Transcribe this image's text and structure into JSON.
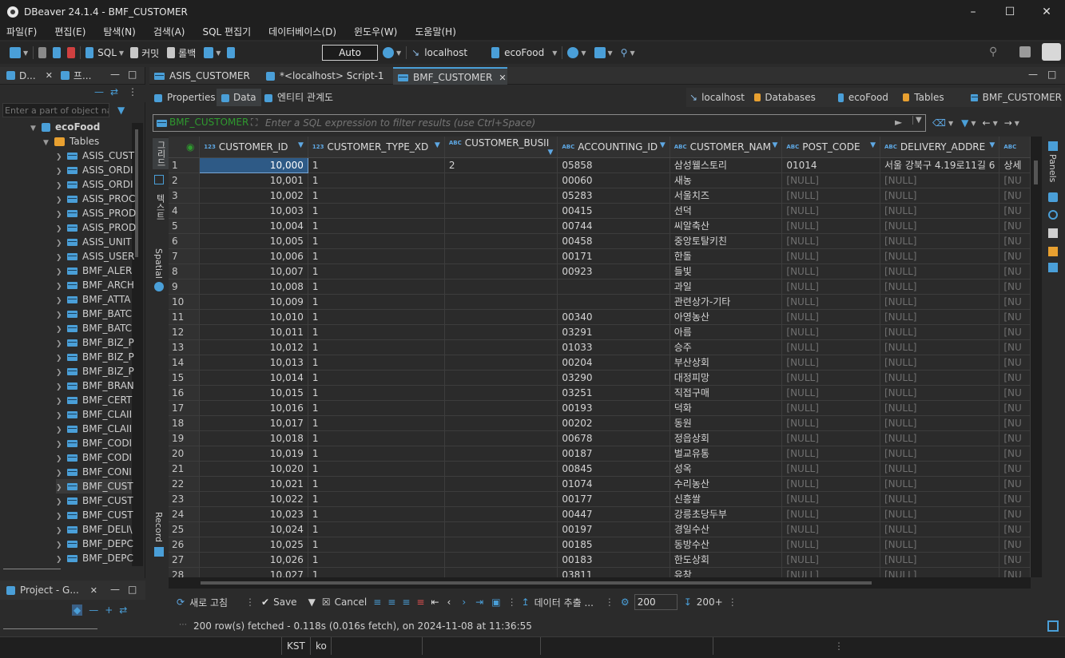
{
  "window": {
    "title": "DBeaver 24.1.4 - BMF_CUSTOMER"
  },
  "menu": [
    "파일(F)",
    "편집(E)",
    "탐색(N)",
    "검색(A)",
    "SQL 편집기",
    "데이터베이스(D)",
    "윈도우(W)",
    "도움말(H)"
  ],
  "toolbar": {
    "sql": "SQL",
    "commit": "커밋",
    "rollback": "롤백",
    "auto": "Auto",
    "connection": "localhost",
    "database": "ecoFood"
  },
  "left": {
    "tabs": [
      "D...",
      "프..."
    ],
    "filter_placeholder": "Enter a part of object na",
    "tree_db": "ecoFood",
    "tree_tables": "Tables",
    "tables": [
      "ASIS_CUST",
      "ASIS_ORDI",
      "ASIS_ORDI",
      "ASIS_PROC",
      "ASIS_PROD",
      "ASIS_PROD",
      "ASIS_UNIT",
      "ASIS_USER",
      "BMF_ALER",
      "BMF_ARCH",
      "BMF_ATTA",
      "BMF_BATC",
      "BMF_BATC",
      "BMF_BIZ_P",
      "BMF_BIZ_P",
      "BMF_BIZ_P",
      "BMF_BRAN",
      "BMF_CERT",
      "BMF_CLAII",
      "BMF_CLAII",
      "BMF_CODI",
      "BMF_CODI",
      "BMF_CONI",
      "BMF_CUST",
      "BMF_CUST",
      "BMF_CUST",
      "BMF_DELI\\",
      "BMF_DEPC",
      "BMF_DEPC"
    ],
    "project_tab": "Project - G..."
  },
  "editor": {
    "tabs": [
      "ASIS_CUSTOMER",
      "*<localhost> Script-1",
      "BMF_CUSTOMER"
    ],
    "subtabs": [
      "Properties",
      "Data",
      "엔티티 관계도"
    ],
    "breadcrumb": [
      "localhost",
      "Databases",
      "ecoFood",
      "Tables",
      "BMF_CUSTOMER"
    ],
    "filter_table": "BMF_CUSTOMER",
    "filter_placeholder": "Enter a SQL expression to filter results (use Ctrl+Space)",
    "side_tabs": [
      "그리드",
      "텍스트",
      "Spatial",
      "Record"
    ],
    "right_panel": "Panels"
  },
  "grid": {
    "columns": [
      {
        "type": "123",
        "name": "CUSTOMER_ID"
      },
      {
        "type": "123",
        "name": "CUSTOMER_TYPE_XD"
      },
      {
        "type": "ABC",
        "name": "CUSTOMER_BUSII"
      },
      {
        "type": "ABC",
        "name": "ACCOUNTING_ID"
      },
      {
        "type": "ABC",
        "name": "CUSTOMER_NAM"
      },
      {
        "type": "ABC",
        "name": "POST_CODE"
      },
      {
        "type": "ABC",
        "name": "DELIVERY_ADDRE"
      },
      {
        "type": "ABC",
        "name": ""
      }
    ],
    "rows": [
      [
        "1",
        "10,000",
        "1",
        "2",
        "05858",
        "삼성웰스토리",
        "01014",
        "서울 강북구 4.19로11길 6",
        "상세"
      ],
      [
        "2",
        "10,001",
        "1",
        "",
        "00060",
        "새농",
        "[NULL]",
        "[NULL]",
        "[NU"
      ],
      [
        "3",
        "10,002",
        "1",
        "",
        "05283",
        "서울치즈",
        "[NULL]",
        "[NULL]",
        "[NU"
      ],
      [
        "4",
        "10,003",
        "1",
        "",
        "00415",
        "선덕",
        "[NULL]",
        "[NULL]",
        "[NU"
      ],
      [
        "5",
        "10,004",
        "1",
        "",
        "00744",
        "씨알축산",
        "[NULL]",
        "[NULL]",
        "[NU"
      ],
      [
        "6",
        "10,005",
        "1",
        "",
        "00458",
        "중앙토탈키친",
        "[NULL]",
        "[NULL]",
        "[NU"
      ],
      [
        "7",
        "10,006",
        "1",
        "",
        "00171",
        "한돌",
        "[NULL]",
        "[NULL]",
        "[NU"
      ],
      [
        "8",
        "10,007",
        "1",
        "",
        "00923",
        "들빛",
        "[NULL]",
        "[NULL]",
        "[NU"
      ],
      [
        "9",
        "10,008",
        "1",
        "",
        "",
        "과일",
        "[NULL]",
        "[NULL]",
        "[NU"
      ],
      [
        "10",
        "10,009",
        "1",
        "",
        "",
        "관련상가-기타",
        "[NULL]",
        "[NULL]",
        "[NU"
      ],
      [
        "11",
        "10,010",
        "1",
        "",
        "00340",
        "아영농산",
        "[NULL]",
        "[NULL]",
        "[NU"
      ],
      [
        "12",
        "10,011",
        "1",
        "",
        "03291",
        "아름",
        "[NULL]",
        "[NULL]",
        "[NU"
      ],
      [
        "13",
        "10,012",
        "1",
        "",
        "01033",
        "승주",
        "[NULL]",
        "[NULL]",
        "[NU"
      ],
      [
        "14",
        "10,013",
        "1",
        "",
        "00204",
        "부산상회",
        "[NULL]",
        "[NULL]",
        "[NU"
      ],
      [
        "15",
        "10,014",
        "1",
        "",
        "03290",
        "대정피망",
        "[NULL]",
        "[NULL]",
        "[NU"
      ],
      [
        "16",
        "10,015",
        "1",
        "",
        "03251",
        "직접구매",
        "[NULL]",
        "[NULL]",
        "[NU"
      ],
      [
        "17",
        "10,016",
        "1",
        "",
        "00193",
        "덕화",
        "[NULL]",
        "[NULL]",
        "[NU"
      ],
      [
        "18",
        "10,017",
        "1",
        "",
        "00202",
        "동원",
        "[NULL]",
        "[NULL]",
        "[NU"
      ],
      [
        "19",
        "10,018",
        "1",
        "",
        "00678",
        "정읍상회",
        "[NULL]",
        "[NULL]",
        "[NU"
      ],
      [
        "20",
        "10,019",
        "1",
        "",
        "00187",
        "벌교유통",
        "[NULL]",
        "[NULL]",
        "[NU"
      ],
      [
        "21",
        "10,020",
        "1",
        "",
        "00845",
        "성옥",
        "[NULL]",
        "[NULL]",
        "[NU"
      ],
      [
        "22",
        "10,021",
        "1",
        "",
        "01074",
        "수리농산",
        "[NULL]",
        "[NULL]",
        "[NU"
      ],
      [
        "23",
        "10,022",
        "1",
        "",
        "00177",
        "신흥쌀",
        "[NULL]",
        "[NULL]",
        "[NU"
      ],
      [
        "24",
        "10,023",
        "1",
        "",
        "00447",
        "강릉초당두부",
        "[NULL]",
        "[NULL]",
        "[NU"
      ],
      [
        "25",
        "10,024",
        "1",
        "",
        "00197",
        "경일수산",
        "[NULL]",
        "[NULL]",
        "[NU"
      ],
      [
        "26",
        "10,025",
        "1",
        "",
        "00185",
        "동방수산",
        "[NULL]",
        "[NULL]",
        "[NU"
      ],
      [
        "27",
        "10,026",
        "1",
        "",
        "00183",
        "한도상회",
        "[NULL]",
        "[NULL]",
        "[NU"
      ],
      [
        "28",
        "10,027",
        "1",
        "",
        "03811",
        "유창",
        "[NULL]",
        "[NULL]",
        "[NU"
      ]
    ]
  },
  "bottom": {
    "refresh": "새로 고침",
    "save": "Save",
    "cancel": "Cancel",
    "export": "데이터 추출 ...",
    "fetch_size": "200",
    "fetch_more": "200+",
    "status": "200 row(s) fetched - 0.118s (0.016s fetch), on 2024-11-08 at 11:36:55"
  },
  "statusbar": {
    "timezone": "KST",
    "locale": "ko"
  },
  "colors": {
    "accent": "#4a9fd8",
    "selection": "#2e5a86",
    "null_text": "#6f6f6f"
  }
}
